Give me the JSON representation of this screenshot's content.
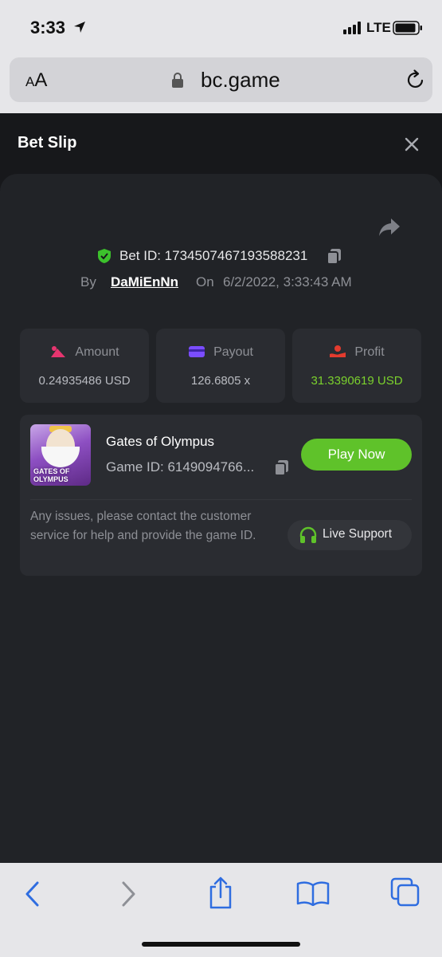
{
  "status": {
    "time": "3:33",
    "network": "LTE"
  },
  "browser": {
    "text_size_small": "A",
    "text_size_large": "A",
    "url": "bc.game"
  },
  "modal": {
    "title": "Bet Slip"
  },
  "bet": {
    "id_label": "Bet ID: 1734507467193588231",
    "by_label": "By",
    "user": "DaMiEnNn",
    "on_label": "On",
    "date": "6/2/2022, 3:33:43 AM"
  },
  "stats": [
    {
      "label": "Amount",
      "value": "0.24935486 USD",
      "icon": "amount-icon",
      "color": "#e6356f"
    },
    {
      "label": "Payout",
      "value": "126.6805 x",
      "icon": "payout-icon",
      "color": "#7b4dff"
    },
    {
      "label": "Profit",
      "value": "31.3390619 USD",
      "icon": "profit-icon",
      "color": "#e33b2e"
    }
  ],
  "game": {
    "name": "Gates of Olympus",
    "id_text": "Game ID: 6149094766...",
    "thumbnail_text": "GATES OF OLYMPUS",
    "play_label": "Play Now",
    "issue_text": "Any issues, please contact the customer service for help and provide the game ID.",
    "support_label": "Live Support"
  },
  "colors": {
    "accent_green": "#5fc22a",
    "profit_green": "#7bd12d",
    "safari_blue": "#2f6de0"
  }
}
